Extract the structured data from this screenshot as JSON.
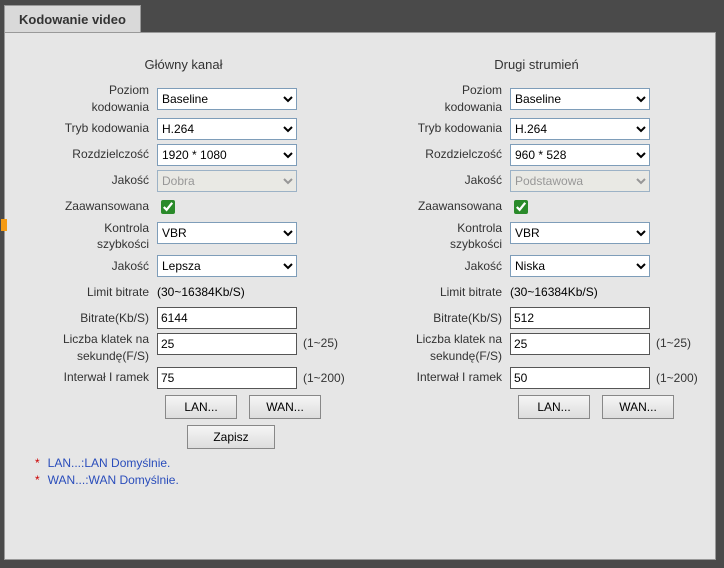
{
  "tab_title": "Kodowanie video",
  "labels": {
    "poziom_kodowania": "Poziom kodowania",
    "tryb_kodowania": "Tryb kodowania",
    "rozdzielczosc": "Rozdzielczość",
    "jakosc": "Jakość",
    "zaawansowana": "Zaawansowana",
    "kontrola_szybkosci": "Kontrola szybkości",
    "jakosc2": "Jakość",
    "limit_bitrate": "Limit bitrate",
    "bitrate": "Bitrate(Kb/S)",
    "liczba_klatek": "Liczba klatek na sekundę(F/S)",
    "interwal": "Interwał I ramek"
  },
  "main": {
    "title": "Główny kanał",
    "poziom_kodowania": "Baseline",
    "tryb_kodowania": "H.264",
    "rozdzielczosc": "1920 * 1080",
    "jakosc": "Dobra",
    "zaawansowana": true,
    "kontrola": "VBR",
    "jakosc2": "Lepsza",
    "limit": "(30~16384Kb/S)",
    "bitrate": "6144",
    "fps": "25",
    "fps_hint": "(1~25)",
    "iframe": "75",
    "iframe_hint": "(1~200)"
  },
  "sub": {
    "title": "Drugi strumień",
    "poziom_kodowania": "Baseline",
    "tryb_kodowania": "H.264",
    "rozdzielczosc": "960 * 528",
    "jakosc": "Podstawowa",
    "zaawansowana": true,
    "kontrola": "VBR",
    "jakosc2": "Niska",
    "limit": "(30~16384Kb/S)",
    "bitrate": "512",
    "fps": "25",
    "fps_hint": "(1~25)",
    "iframe": "50",
    "iframe_hint": "(1~200)"
  },
  "buttons": {
    "lan": "LAN...",
    "wan": "WAN...",
    "save": "Zapisz"
  },
  "footnotes": {
    "lan": "LAN...:LAN Domyślnie.",
    "wan": "WAN...:WAN Domyślnie."
  }
}
